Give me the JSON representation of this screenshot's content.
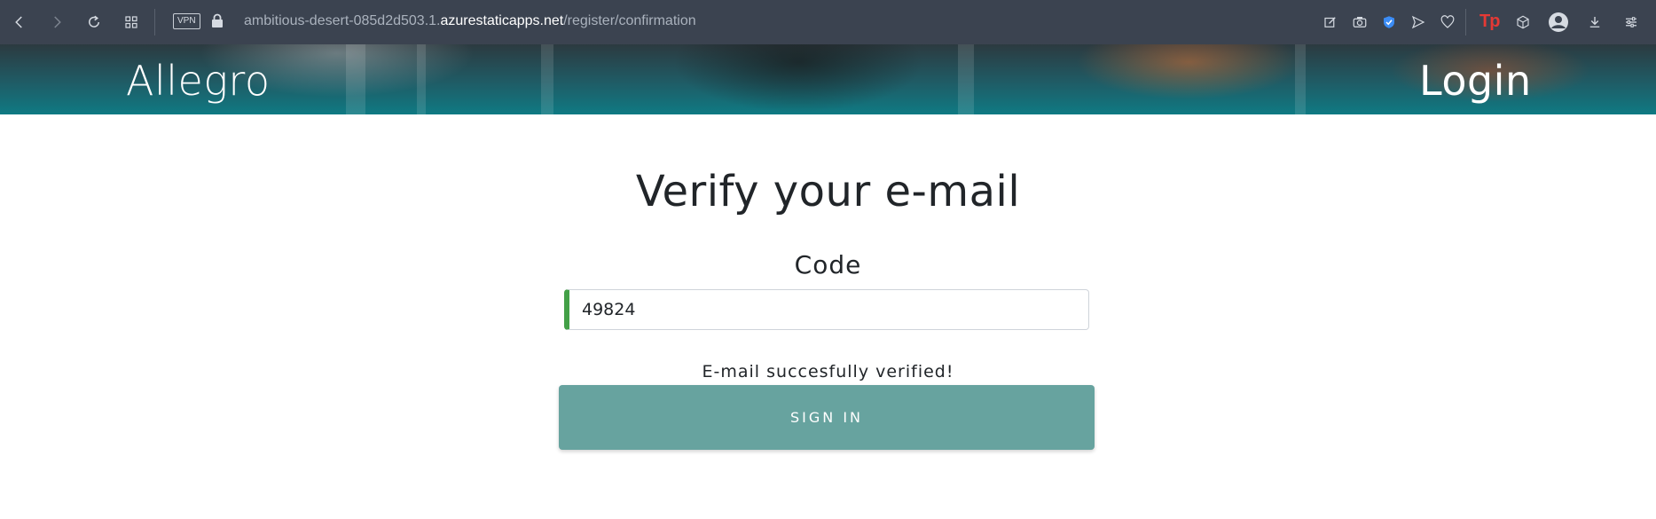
{
  "browser": {
    "vpn_label": "VPN",
    "url_prefix": "ambitious-desert-085d2d503.1.",
    "url_host": "azurestaticapps.net",
    "url_path": "/register/confirmation",
    "tp_label": "Tp",
    "icons_left": [
      "back-icon",
      "forward-icon",
      "reload-icon",
      "tabs-grid-icon"
    ],
    "icons_right": [
      "edit-icon",
      "camera-icon",
      "shield-icon",
      "send-icon",
      "heart-icon",
      "tp-extension-icon",
      "cube-icon",
      "avatar",
      "download-icon",
      "settings-icon"
    ]
  },
  "header": {
    "brand": "Allegro",
    "login_link": "Login"
  },
  "main": {
    "title": "Verify your e-mail",
    "code_label": "Code",
    "code_value": "49824",
    "status_message": "E-mail succesfully verified!",
    "sign_in_label": "SIGN IN",
    "valid_color": "#43a047",
    "button_color": "#67a39f"
  }
}
